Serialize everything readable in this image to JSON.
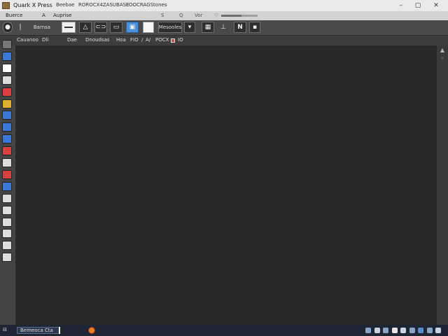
{
  "window": {
    "title": "Quark X Press",
    "title_menus": [
      "Beebae",
      "ROROCX4ZASUBASE",
      "FOOCRAGStones"
    ],
    "controls": [
      "–",
      "▢",
      "✕"
    ]
  },
  "menubar": {
    "items": [
      "Buerce",
      "A",
      "Auprise",
      "S",
      "Q",
      "Vor",
      "♡"
    ],
    "progress_fraction": 0.55
  },
  "toolbar": {
    "label": "Barnsa",
    "items": [
      "Pointer",
      "Text",
      "Pen",
      "Link",
      "Frame",
      "Image",
      "Page"
    ],
    "dropdown_label": "Mesooles",
    "icon_items": [
      "Grid",
      "Align",
      "T",
      "N",
      "Item"
    ]
  },
  "controls_bar": {
    "items": [
      "Cauanoo",
      "Dli",
      "Dae",
      "Dnoudsas",
      "Hoa",
      "FIO",
      "/",
      "A/",
      "POCX"
    ],
    "value": "IO",
    "swatch_color": "#c0504d"
  },
  "tool_panel": {
    "tools": [
      {
        "name": "hand-icon",
        "color": "#777777"
      },
      {
        "name": "frame-icon",
        "color": "#3b78d8"
      },
      {
        "name": "play-icon",
        "color": "#ffffff"
      },
      {
        "name": "content-icon",
        "color": "#dddddd"
      },
      {
        "name": "shape-icon",
        "color": "#d94040"
      },
      {
        "name": "image-icon",
        "color": "#e0b030"
      },
      {
        "name": "color-icon",
        "color": "#3b78d8"
      },
      {
        "name": "rectangle-icon",
        "color": "#3b78d8"
      },
      {
        "name": "picture-icon",
        "color": "#3b78d8"
      },
      {
        "name": "star-icon",
        "color": "#d94040"
      },
      {
        "name": "pen-icon",
        "color": "#dddddd"
      },
      {
        "name": "fill-icon",
        "color": "#d94040"
      },
      {
        "name": "link-icon",
        "color": "#3b78d8"
      },
      {
        "name": "oval-icon",
        "color": "#dddddd"
      },
      {
        "name": "target-icon",
        "color": "#dddddd"
      },
      {
        "name": "bezier-icon",
        "color": "#dddddd"
      },
      {
        "name": "table-icon",
        "color": "#dddddd"
      },
      {
        "name": "box-icon",
        "color": "#dddddd"
      },
      {
        "name": "paper-icon",
        "color": "#dddddd"
      }
    ]
  },
  "statusbar": {
    "left": "⊟",
    "field": "Bemeoca Cta",
    "alert_icon": "fire-icon",
    "right_icons": [
      "settings-icon",
      "view-icon",
      "zoom-icon",
      "print-icon",
      "note-icon",
      "check-icon",
      "chart-icon",
      "grid-icon",
      "expand-icon"
    ]
  }
}
